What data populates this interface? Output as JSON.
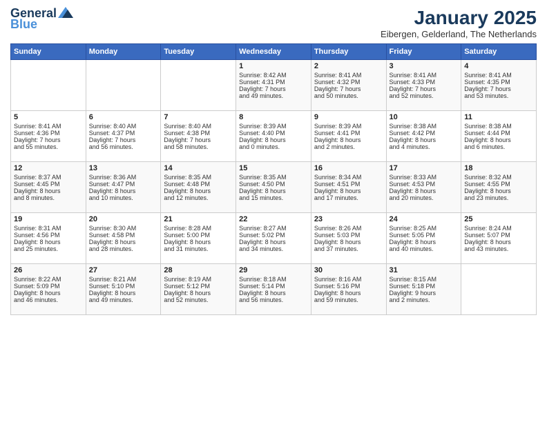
{
  "logo": {
    "line1": "General",
    "line2": "Blue"
  },
  "title": "January 2025",
  "subtitle": "Eibergen, Gelderland, The Netherlands",
  "weekdays": [
    "Sunday",
    "Monday",
    "Tuesday",
    "Wednesday",
    "Thursday",
    "Friday",
    "Saturday"
  ],
  "weeks": [
    [
      {
        "day": "",
        "info": ""
      },
      {
        "day": "",
        "info": ""
      },
      {
        "day": "",
        "info": ""
      },
      {
        "day": "1",
        "info": "Sunrise: 8:42 AM\nSunset: 4:31 PM\nDaylight: 7 hours\nand 49 minutes."
      },
      {
        "day": "2",
        "info": "Sunrise: 8:41 AM\nSunset: 4:32 PM\nDaylight: 7 hours\nand 50 minutes."
      },
      {
        "day": "3",
        "info": "Sunrise: 8:41 AM\nSunset: 4:33 PM\nDaylight: 7 hours\nand 52 minutes."
      },
      {
        "day": "4",
        "info": "Sunrise: 8:41 AM\nSunset: 4:35 PM\nDaylight: 7 hours\nand 53 minutes."
      }
    ],
    [
      {
        "day": "5",
        "info": "Sunrise: 8:41 AM\nSunset: 4:36 PM\nDaylight: 7 hours\nand 55 minutes."
      },
      {
        "day": "6",
        "info": "Sunrise: 8:40 AM\nSunset: 4:37 PM\nDaylight: 7 hours\nand 56 minutes."
      },
      {
        "day": "7",
        "info": "Sunrise: 8:40 AM\nSunset: 4:38 PM\nDaylight: 7 hours\nand 58 minutes."
      },
      {
        "day": "8",
        "info": "Sunrise: 8:39 AM\nSunset: 4:40 PM\nDaylight: 8 hours\nand 0 minutes."
      },
      {
        "day": "9",
        "info": "Sunrise: 8:39 AM\nSunset: 4:41 PM\nDaylight: 8 hours\nand 2 minutes."
      },
      {
        "day": "10",
        "info": "Sunrise: 8:38 AM\nSunset: 4:42 PM\nDaylight: 8 hours\nand 4 minutes."
      },
      {
        "day": "11",
        "info": "Sunrise: 8:38 AM\nSunset: 4:44 PM\nDaylight: 8 hours\nand 6 minutes."
      }
    ],
    [
      {
        "day": "12",
        "info": "Sunrise: 8:37 AM\nSunset: 4:45 PM\nDaylight: 8 hours\nand 8 minutes."
      },
      {
        "day": "13",
        "info": "Sunrise: 8:36 AM\nSunset: 4:47 PM\nDaylight: 8 hours\nand 10 minutes."
      },
      {
        "day": "14",
        "info": "Sunrise: 8:35 AM\nSunset: 4:48 PM\nDaylight: 8 hours\nand 12 minutes."
      },
      {
        "day": "15",
        "info": "Sunrise: 8:35 AM\nSunset: 4:50 PM\nDaylight: 8 hours\nand 15 minutes."
      },
      {
        "day": "16",
        "info": "Sunrise: 8:34 AM\nSunset: 4:51 PM\nDaylight: 8 hours\nand 17 minutes."
      },
      {
        "day": "17",
        "info": "Sunrise: 8:33 AM\nSunset: 4:53 PM\nDaylight: 8 hours\nand 20 minutes."
      },
      {
        "day": "18",
        "info": "Sunrise: 8:32 AM\nSunset: 4:55 PM\nDaylight: 8 hours\nand 23 minutes."
      }
    ],
    [
      {
        "day": "19",
        "info": "Sunrise: 8:31 AM\nSunset: 4:56 PM\nDaylight: 8 hours\nand 25 minutes."
      },
      {
        "day": "20",
        "info": "Sunrise: 8:30 AM\nSunset: 4:58 PM\nDaylight: 8 hours\nand 28 minutes."
      },
      {
        "day": "21",
        "info": "Sunrise: 8:28 AM\nSunset: 5:00 PM\nDaylight: 8 hours\nand 31 minutes."
      },
      {
        "day": "22",
        "info": "Sunrise: 8:27 AM\nSunset: 5:02 PM\nDaylight: 8 hours\nand 34 minutes."
      },
      {
        "day": "23",
        "info": "Sunrise: 8:26 AM\nSunset: 5:03 PM\nDaylight: 8 hours\nand 37 minutes."
      },
      {
        "day": "24",
        "info": "Sunrise: 8:25 AM\nSunset: 5:05 PM\nDaylight: 8 hours\nand 40 minutes."
      },
      {
        "day": "25",
        "info": "Sunrise: 8:24 AM\nSunset: 5:07 PM\nDaylight: 8 hours\nand 43 minutes."
      }
    ],
    [
      {
        "day": "26",
        "info": "Sunrise: 8:22 AM\nSunset: 5:09 PM\nDaylight: 8 hours\nand 46 minutes."
      },
      {
        "day": "27",
        "info": "Sunrise: 8:21 AM\nSunset: 5:10 PM\nDaylight: 8 hours\nand 49 minutes."
      },
      {
        "day": "28",
        "info": "Sunrise: 8:19 AM\nSunset: 5:12 PM\nDaylight: 8 hours\nand 52 minutes."
      },
      {
        "day": "29",
        "info": "Sunrise: 8:18 AM\nSunset: 5:14 PM\nDaylight: 8 hours\nand 56 minutes."
      },
      {
        "day": "30",
        "info": "Sunrise: 8:16 AM\nSunset: 5:16 PM\nDaylight: 8 hours\nand 59 minutes."
      },
      {
        "day": "31",
        "info": "Sunrise: 8:15 AM\nSunset: 5:18 PM\nDaylight: 9 hours\nand 2 minutes."
      },
      {
        "day": "",
        "info": ""
      }
    ]
  ]
}
